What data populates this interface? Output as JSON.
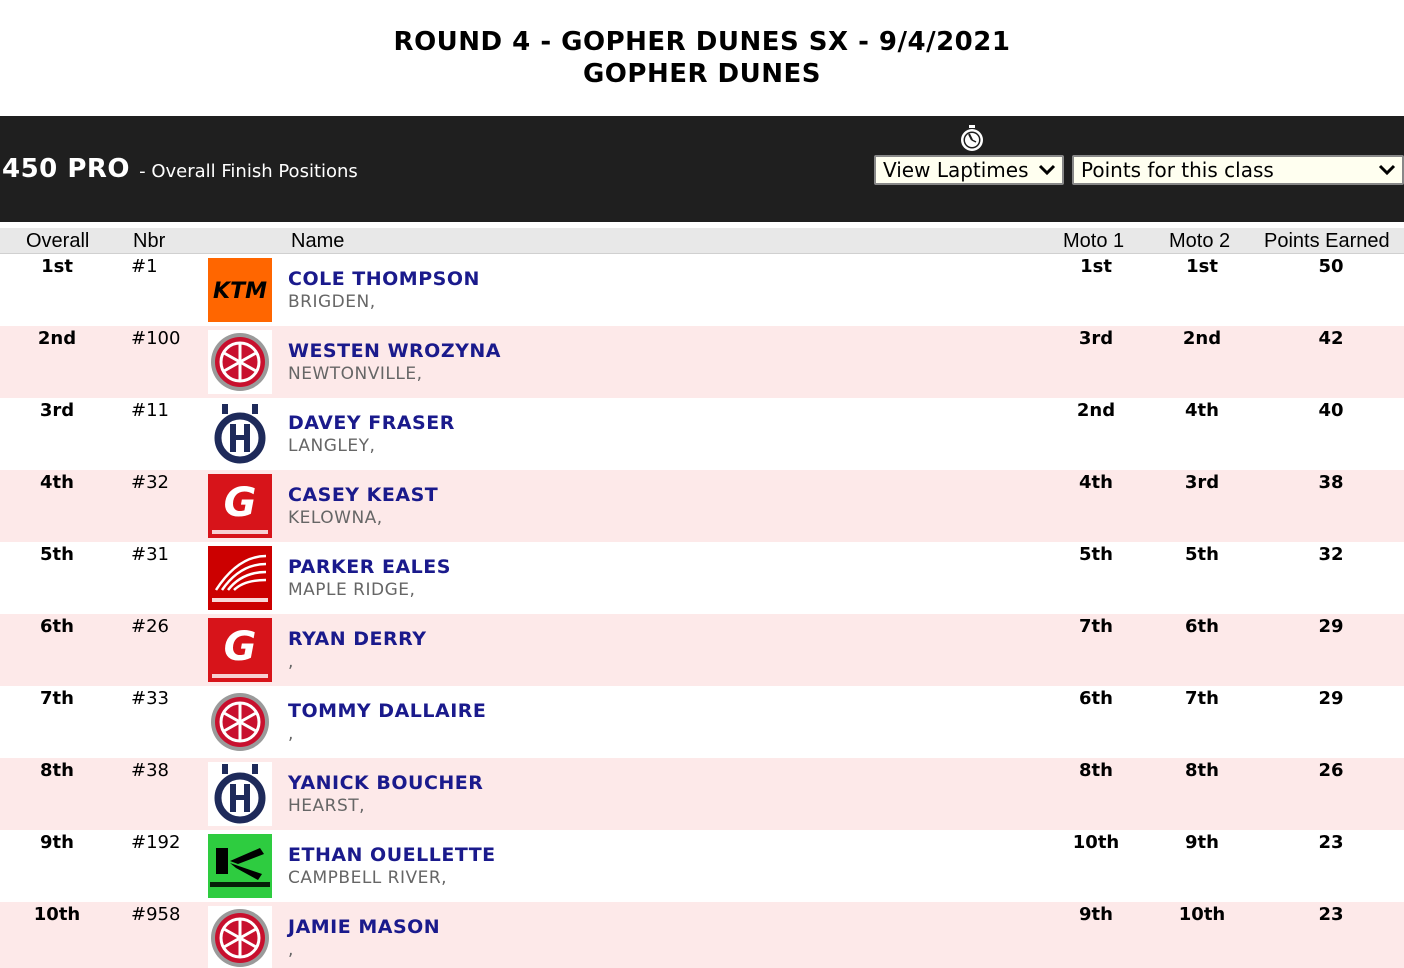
{
  "event": {
    "title": "ROUND 4 - GOPHER DUNES SX - 9/4/2021",
    "venue": "GOPHER DUNES"
  },
  "class_bar": {
    "class_name": "450 PRO",
    "subtitle": "- Overall Finish Positions",
    "laptimes_select": "View Laptimes",
    "points_select": "Points for this class",
    "icon": "stopwatch-icon"
  },
  "columns": {
    "overall": "Overall",
    "nbr": "Nbr",
    "name": "Name",
    "moto1": "Moto 1",
    "moto2": "Moto 2",
    "points": "Points Earned"
  },
  "brand_colors": {
    "ktm": "#ff6600",
    "yamaha": "#c8102e",
    "husqvarna": "#1e2a5a",
    "gasgas": "#d7141a",
    "honda": "#cc0000",
    "kawasaki": "#2ecc40",
    "name_link": "#1a1a8c",
    "alt_row": "#fde9e9",
    "bar": "#1f1f1f"
  },
  "rows": [
    {
      "overall": "1st",
      "nbr": "#1",
      "brand": "ktm",
      "name": "COLE THOMPSON",
      "hometown": "BRIGDEN,",
      "moto1": "1st",
      "moto2": "1st",
      "points": "50"
    },
    {
      "overall": "2nd",
      "nbr": "#100",
      "brand": "yamaha",
      "name": "WESTEN WROZYNA",
      "hometown": "NEWTONVILLE,",
      "moto1": "3rd",
      "moto2": "2nd",
      "points": "42"
    },
    {
      "overall": "3rd",
      "nbr": "#11",
      "brand": "husqvarna",
      "name": "DAVEY FRASER",
      "hometown": "LANGLEY,",
      "moto1": "2nd",
      "moto2": "4th",
      "points": "40"
    },
    {
      "overall": "4th",
      "nbr": "#32",
      "brand": "gasgas",
      "name": "CASEY KEAST",
      "hometown": "KELOWNA,",
      "moto1": "4th",
      "moto2": "3rd",
      "points": "38"
    },
    {
      "overall": "5th",
      "nbr": "#31",
      "brand": "honda",
      "name": "PARKER EALES",
      "hometown": "MAPLE RIDGE,",
      "moto1": "5th",
      "moto2": "5th",
      "points": "32"
    },
    {
      "overall": "6th",
      "nbr": "#26",
      "brand": "gasgas",
      "name": "RYAN DERRY",
      "hometown": ",",
      "moto1": "7th",
      "moto2": "6th",
      "points": "29"
    },
    {
      "overall": "7th",
      "nbr": "#33",
      "brand": "yamaha",
      "name": "TOMMY DALLAIRE",
      "hometown": ",",
      "moto1": "6th",
      "moto2": "7th",
      "points": "29"
    },
    {
      "overall": "8th",
      "nbr": "#38",
      "brand": "husqvarna",
      "name": "YANICK BOUCHER",
      "hometown": "HEARST,",
      "moto1": "8th",
      "moto2": "8th",
      "points": "26"
    },
    {
      "overall": "9th",
      "nbr": "#192",
      "brand": "kawasaki",
      "name": "ETHAN OUELLETTE",
      "hometown": "CAMPBELL RIVER,",
      "moto1": "10th",
      "moto2": "9th",
      "points": "23"
    },
    {
      "overall": "10th",
      "nbr": "#958",
      "brand": "yamaha",
      "name": "JAMIE MASON",
      "hometown": ",",
      "moto1": "9th",
      "moto2": "10th",
      "points": "23"
    }
  ]
}
